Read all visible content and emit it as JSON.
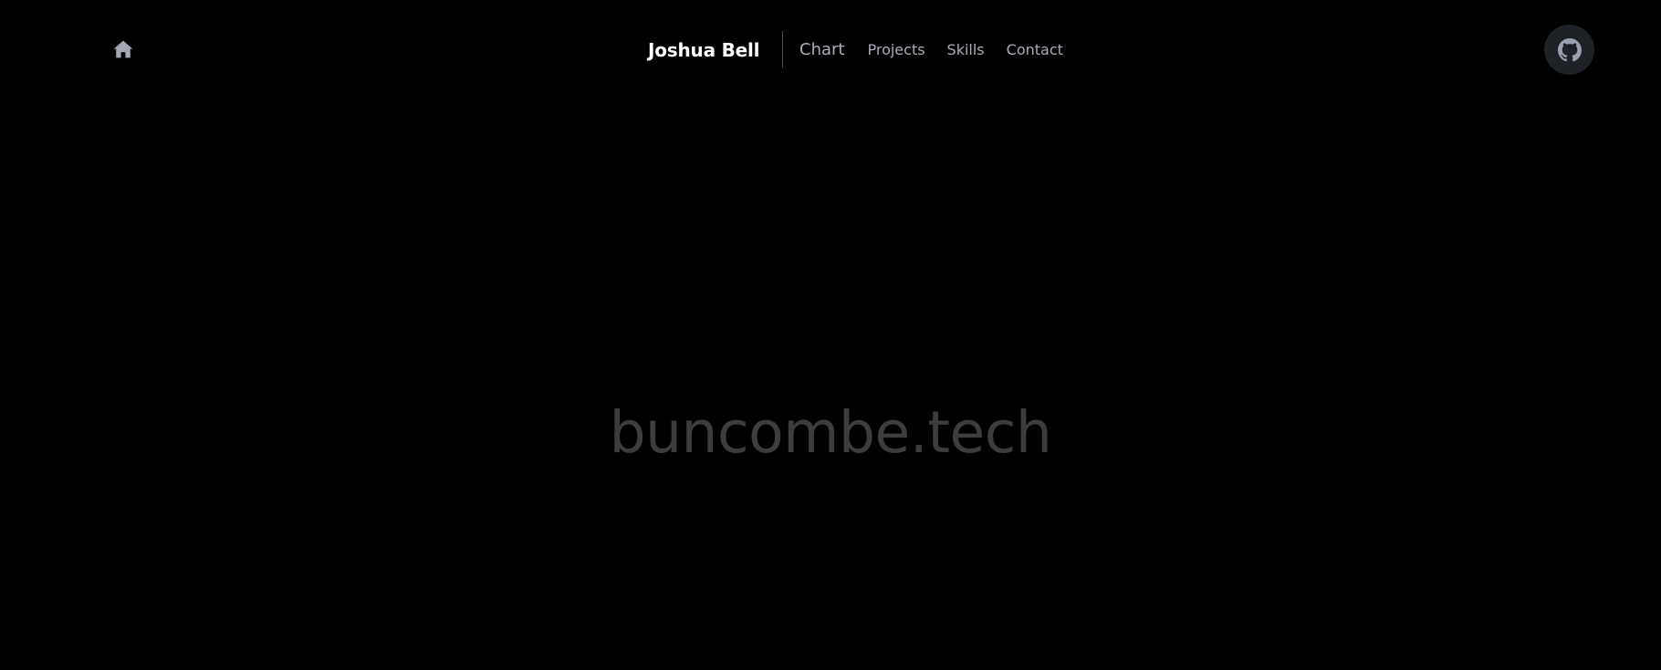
{
  "header": {
    "home_icon": "home-icon",
    "brand": "Joshua Bell",
    "nav": [
      {
        "label": "Chart"
      },
      {
        "label": "Projects"
      },
      {
        "label": "Skills"
      },
      {
        "label": "Contact"
      }
    ],
    "github_icon": "github-icon"
  },
  "hero": {
    "title": "buncombe.tech"
  },
  "colors": {
    "background": "#000000",
    "brand_text": "#ffffff",
    "nav_text": "#a9adb8",
    "hero_text": "#3d3d3d",
    "github_button_bg": "#1e2126",
    "icon": "#9aa0ac"
  }
}
